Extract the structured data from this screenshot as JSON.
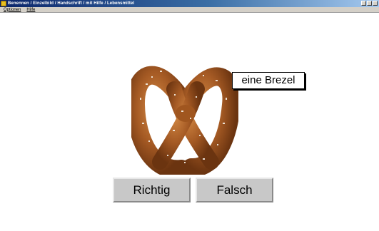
{
  "window": {
    "title": "Benennen / Einzelbild / Handschrift / mit Hilfe / Lebensmittel"
  },
  "menu": {
    "items": [
      {
        "label": "Optionen"
      },
      {
        "label": "Hilfe"
      }
    ]
  },
  "stimulus": {
    "label": "eine Brezel",
    "image_icon": "pretzel"
  },
  "answers": {
    "correct_label": "Richtig",
    "wrong_label": "Falsch"
  },
  "colors": {
    "titlebar": "#0a246a",
    "button_face": "#c8c8c8",
    "pretzel": "#a55a24"
  }
}
